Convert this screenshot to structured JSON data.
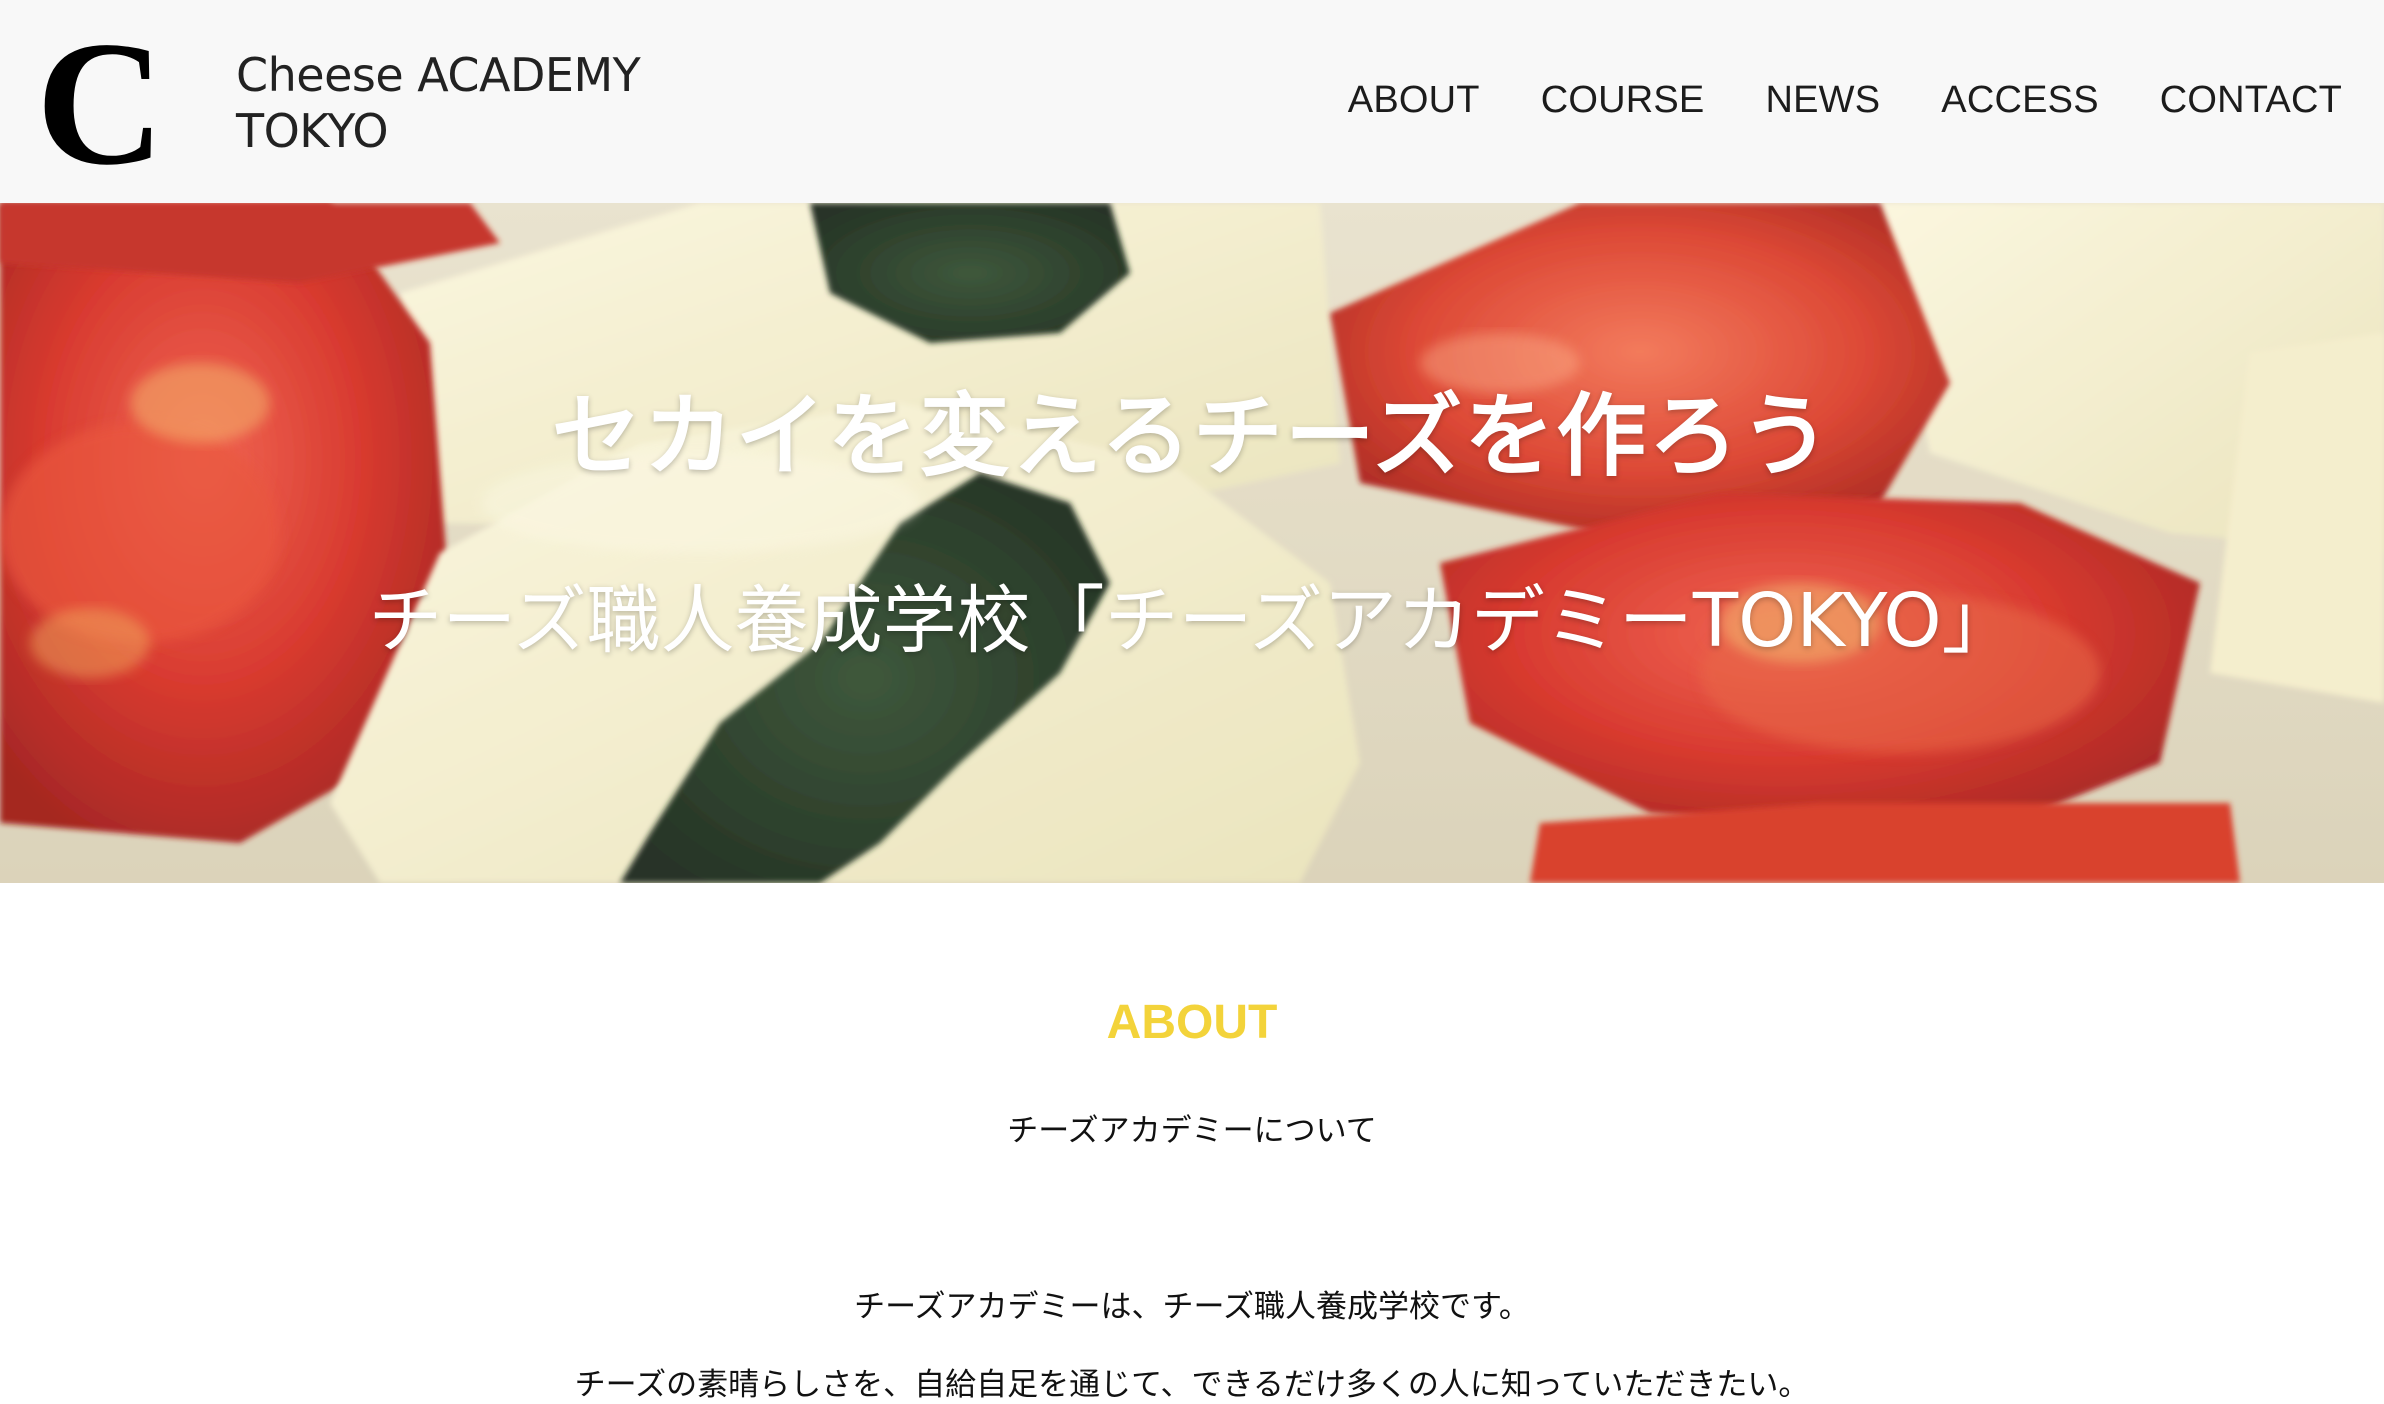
{
  "header": {
    "logo_mark": "C",
    "logo_line1": "Cheese ACADEMY",
    "logo_line2": "TOKYO",
    "nav": [
      "ABOUT",
      "COURSE",
      "NEWS",
      "ACCESS",
      "CONTACT"
    ]
  },
  "hero": {
    "title": "セカイを変えるチーズを作ろう",
    "subtitle": "チーズ職人養成学校「チーズアカデミーTOKYO」"
  },
  "about": {
    "heading": "ABOUT",
    "subheading": "チーズアカデミーについて",
    "paragraph1": "チーズアカデミーは、チーズ職人養成学校です。",
    "paragraph2": "チーズの素晴らしさを、自給自足を通じて、できるだけ多くの人に知っていただきたい。"
  },
  "colors": {
    "accent": "#f3d33a",
    "header_bg": "#f8f8f8",
    "text": "#111111"
  }
}
